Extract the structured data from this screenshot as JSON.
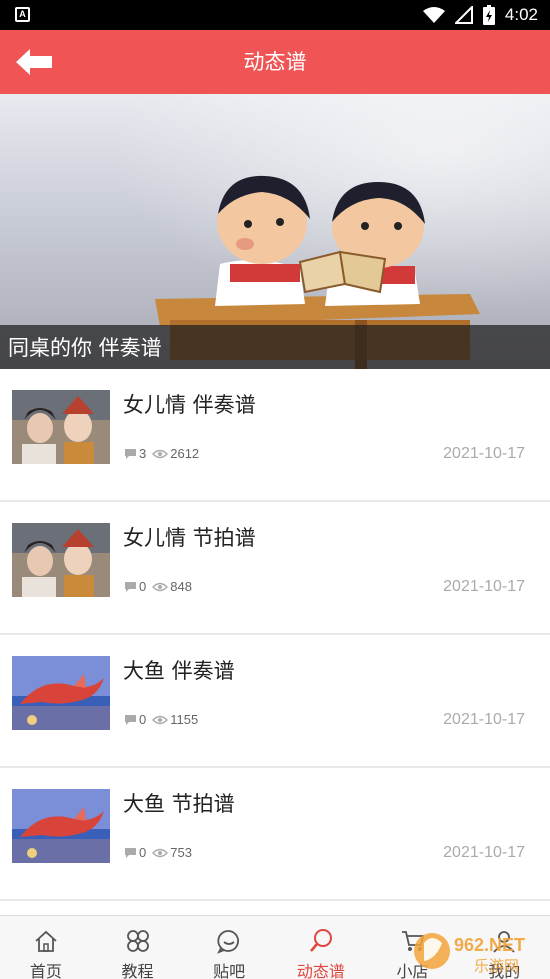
{
  "status_bar": {
    "left_icon": "A",
    "time": "4:02",
    "icons": [
      "wifi-icon",
      "signal-icon",
      "battery-charging-icon"
    ]
  },
  "header": {
    "title": "动态谱",
    "back_icon": "back-arrow-icon",
    "color": "#f05454"
  },
  "banner": {
    "caption": "同桌的你 伴奏谱",
    "sign_text": "同桌的你"
  },
  "list": [
    {
      "title": "女儿情 伴奏谱",
      "comments": "3",
      "views": "2612",
      "date": "2021-10-17",
      "thumb": "opera-couple"
    },
    {
      "title": "女儿情 节拍谱",
      "comments": "0",
      "views": "848",
      "date": "2021-10-17",
      "thumb": "opera-couple"
    },
    {
      "title": "大鱼 伴奏谱",
      "comments": "0",
      "views": "1155",
      "date": "2021-10-17",
      "thumb": "big-fish"
    },
    {
      "title": "大鱼 节拍谱",
      "comments": "0",
      "views": "753",
      "date": "2021-10-17",
      "thumb": "big-fish"
    }
  ],
  "bottom_nav": {
    "items": [
      {
        "label": "首页",
        "icon": "home-icon",
        "active": false
      },
      {
        "label": "教程",
        "icon": "grid-icon",
        "active": false
      },
      {
        "label": "贴吧",
        "icon": "chat-icon",
        "active": false
      },
      {
        "label": "动态谱",
        "icon": "search-icon",
        "active": true
      },
      {
        "label": "小店",
        "icon": "cart-icon",
        "active": false
      },
      {
        "label": "我的",
        "icon": "user-icon",
        "active": false
      }
    ],
    "active_color": "#e0453f"
  },
  "watermark": {
    "text": "962.NET",
    "subtext": "乐游网"
  }
}
